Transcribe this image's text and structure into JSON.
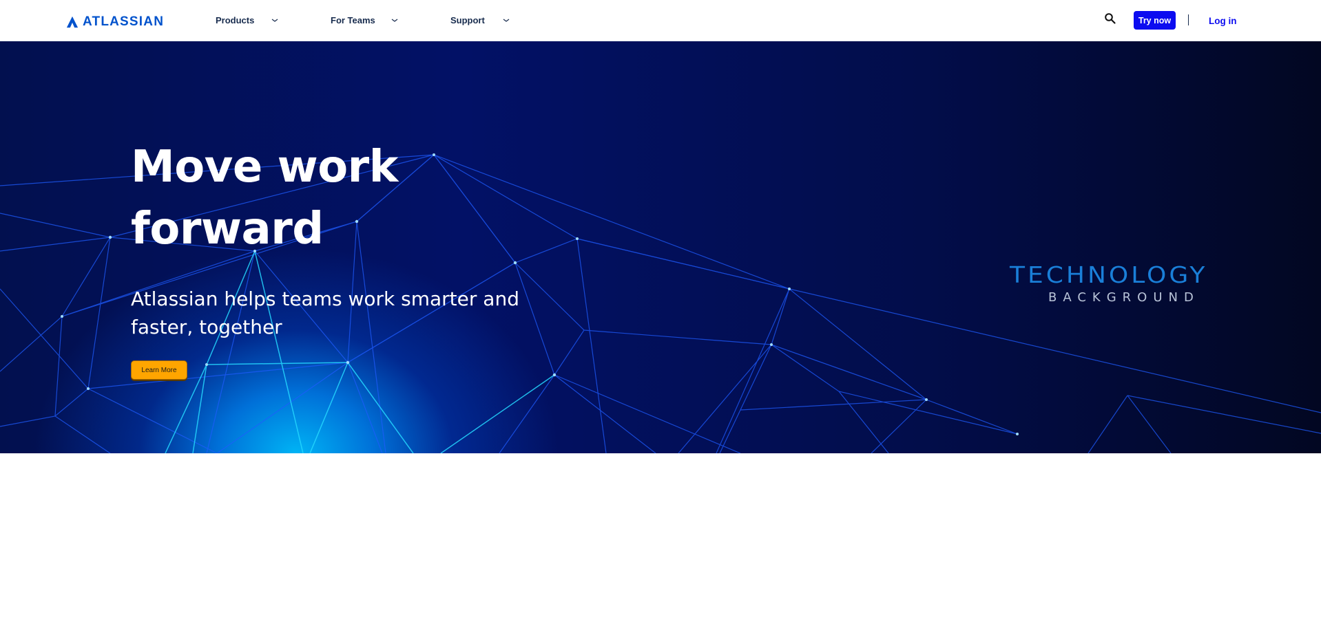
{
  "header": {
    "logo_text": "ATLASSIAN",
    "logo_icon": "atlassian-logo-icon",
    "nav": [
      {
        "label": "Products",
        "icon": "chevron-down-icon"
      },
      {
        "label": "For Teams",
        "icon": "chevron-down-icon"
      },
      {
        "label": "Support",
        "icon": "chevron-down-icon"
      }
    ],
    "search_icon": "search-icon",
    "try_label": "Try now",
    "divider": "|",
    "login_label": "Log in"
  },
  "hero": {
    "title_line1": "Move work",
    "title_line2": "forward",
    "subtitle": "Atlassian helps teams work smarter and faster, together",
    "cta_label": "Learn More",
    "image_text_main": "TECHNOLOGY",
    "image_text_sub": "BACKGROUND"
  },
  "colors": {
    "brand": "#0052cc",
    "primary_button": "#0c0cf0",
    "cta": "#ffa500",
    "hero_bg": "#021166"
  }
}
